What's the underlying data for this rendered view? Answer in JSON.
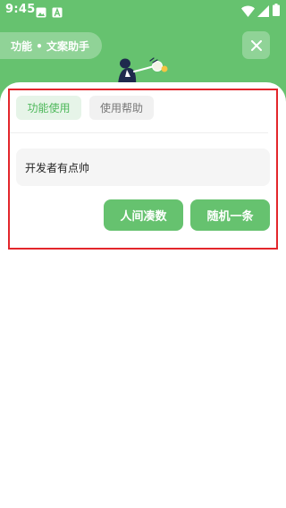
{
  "status_bar": {
    "time": "9:45",
    "left_icons": [
      "image-icon",
      "a-icon"
    ],
    "right_icons": [
      "wifi-icon",
      "signal-icon",
      "battery-icon"
    ]
  },
  "header": {
    "title": "功能 • 文案助手",
    "close_icon": "close-icon"
  },
  "tabs": [
    {
      "label": "功能使用",
      "active": true
    },
    {
      "label": "使用帮助",
      "active": false
    }
  ],
  "content": {
    "text": "开发者有点帅"
  },
  "actions": {
    "left_label": "人间凑数",
    "right_label": "随机一条"
  },
  "colors": {
    "accent": "#66c26f",
    "tab_active_bg": "#e6f4e8",
    "tab_active_text": "#4db85a",
    "highlight": "#e3262b"
  }
}
